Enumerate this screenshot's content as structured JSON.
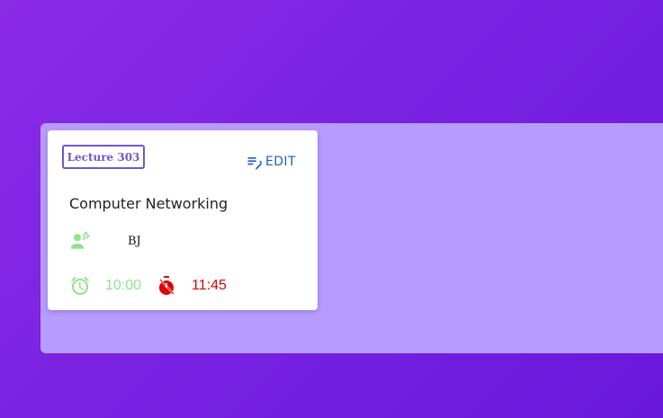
{
  "card": {
    "lecture_label": "Lecture 303",
    "edit_label": "EDIT",
    "course_title": "Computer Networking",
    "teacher_initials": "BJ",
    "start_time": "10:00",
    "end_time": "11:45"
  },
  "icons": {
    "edit": "edit-note-icon",
    "teacher": "teacher-icon",
    "start": "alarm-icon",
    "end": "timer-off-icon"
  },
  "colors": {
    "background_gradient_start": "#8b2be6",
    "background_gradient_end": "#6a18dc",
    "panel": "#b79bff",
    "card": "#ffffff",
    "badge_border": "#6a5acd",
    "edit": "#1f5fc6",
    "start_time": "#8fe38f",
    "end_time": "#e00000"
  }
}
